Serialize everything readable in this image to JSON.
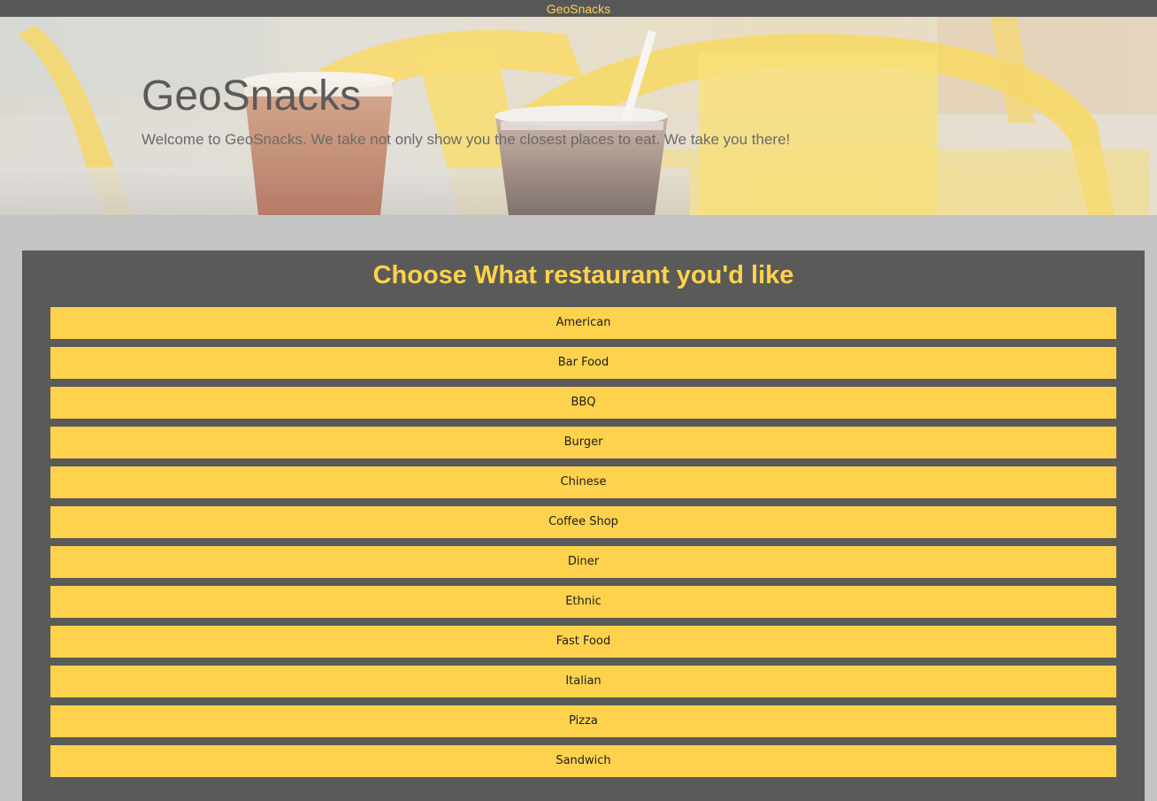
{
  "header": {
    "title": "GeoSnacks"
  },
  "hero": {
    "title": "GeoSnacks",
    "subtitle": "Welcome to GeoSnacks. We take not only show you the closest places to eat. We take you there!"
  },
  "panel": {
    "heading": "Choose What restaurant you'd like",
    "options": [
      "American",
      "Bar Food",
      "BBQ",
      "Burger",
      "Chinese",
      "Coffee Shop",
      "Diner",
      "Ethnic",
      "Fast Food",
      "Italian",
      "Pizza",
      "Sandwich"
    ]
  },
  "colors": {
    "accent": "#ffd24d",
    "dark": "#575757",
    "background": "#c4c4c4"
  }
}
